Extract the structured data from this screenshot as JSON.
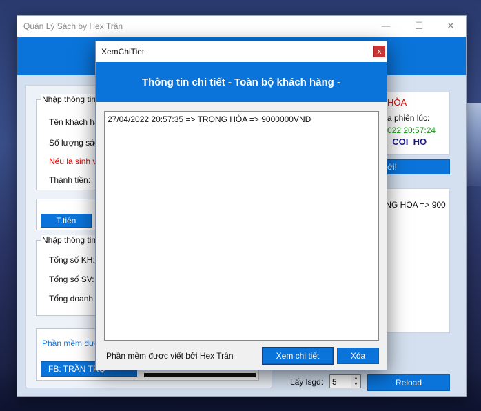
{
  "main_window": {
    "title": "Quản Lý Sách by Hex Trần",
    "controls": {
      "minimize": "—",
      "maximize": "☐",
      "close": "✕"
    }
  },
  "left_panel": {
    "customer_group": {
      "legend": "Nhập thông tin",
      "customer_name_label": "Tên khách hà",
      "book_quantity_label": "Số lượng sác",
      "student_note": "Nếu là sinh v",
      "amount_label": "Thành tiền:"
    },
    "calc_button": "T.tiền",
    "stats_group": {
      "legend": "Nhập thông tin",
      "total_customers_label": "Tổng số KH:",
      "total_students_label": "Tổng số SV:",
      "total_revenue_label": "Tổng doanh"
    },
    "credit_link": "Phần mềm được",
    "facebook_button": "FB: TRẦN TRỌ"
  },
  "right_panel": {
    "user_name": "HÒA",
    "session_label": "a phiên lúc:",
    "session_time": "022 20:57:24",
    "user_handle": "_COI_HO",
    "new_button": "ới!",
    "log_entry": "ỌNG HÒA => 900",
    "take_label": "Lấy lsgd:",
    "take_value": "5",
    "reload_button": "Reload"
  },
  "dialog": {
    "title": "XemChiTiet",
    "close_glyph": "x",
    "heading": "Thông tin chi tiết - Toàn bộ khách hàng -",
    "entries": [
      "27/04/2022 20:57:35 => TRỌNG HÒA => 9000000VNĐ"
    ],
    "credit": "Phần mềm được viết bởi Hex Trần",
    "view_details_button": "Xem chi tiết",
    "delete_button": "Xóa"
  },
  "colors": {
    "accent": "#0a74da",
    "error_text": "#e00000",
    "session_time_text": "#119911",
    "handle_text": "#1a1a8c",
    "link_text": "#1a73d9"
  }
}
